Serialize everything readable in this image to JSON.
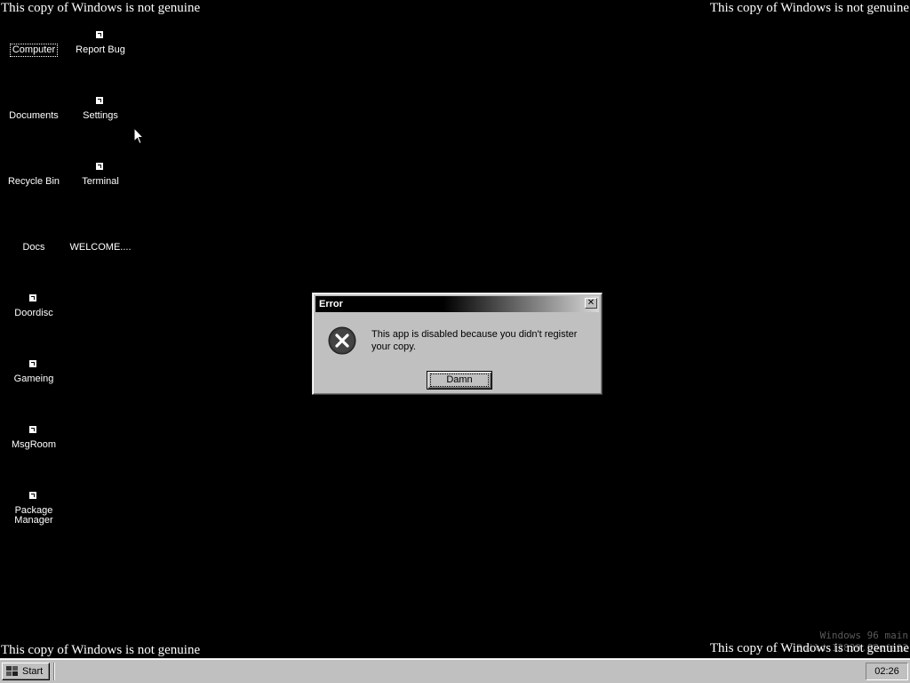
{
  "watermark": {
    "top_left": "This copy of Windows is not genuine",
    "top_right": "This copy of Windows is not genuine",
    "bottom_left": "This copy of Windows is not genuine",
    "bottom_right": "This copy of Windows is not genuine"
  },
  "build": {
    "line1": "Windows 96 main",
    "line2": "Build 12839.88efa92"
  },
  "desktop_icons": {
    "computer": {
      "label": "Computer",
      "icon": "computer-icon"
    },
    "report_bug": {
      "label": "Report Bug",
      "icon": "report-bug-icon"
    },
    "documents": {
      "label": "Documents",
      "icon": "documents-icon"
    },
    "settings": {
      "label": "Settings",
      "icon": "settings-icon"
    },
    "recycle_bin": {
      "label": "Recycle Bin",
      "icon": "recycle-bin-icon"
    },
    "terminal": {
      "label": "Terminal",
      "icon": "terminal-icon"
    },
    "docs": {
      "label": "Docs",
      "icon": "docs-icon"
    },
    "welcome": {
      "label": "WELCOME....",
      "icon": "welcome-icon"
    },
    "doordisc": {
      "label": "Doordisc",
      "icon": "doordisc-icon"
    },
    "gameing": {
      "label": "Gameing",
      "icon": "gameing-icon"
    },
    "msgroom": {
      "label": "MsgRoom",
      "icon": "msgroom-icon"
    },
    "package_manager": {
      "label": "Package Manager",
      "icon": "package-manager-icon"
    }
  },
  "dialog": {
    "title": "Error",
    "close_glyph": "✕",
    "message": "This app is disabled because you didn't register your copy.",
    "button_label": "Damn",
    "icon": "error-icon"
  },
  "taskbar": {
    "start_label": "Start",
    "clock": "02:26"
  },
  "colors": {
    "desktop": "#000000",
    "chrome": "#c0c0c0",
    "title_active": "#000000",
    "watermark_text": "#ffffff"
  }
}
